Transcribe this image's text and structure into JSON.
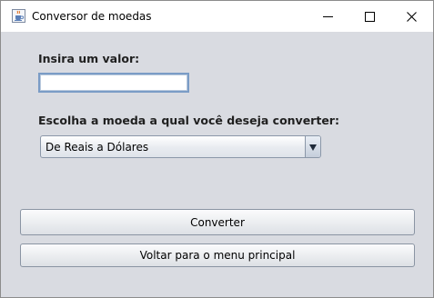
{
  "window": {
    "title": "Conversor de moedas",
    "icon": "java-cup-icon",
    "controls": [
      "minimize-icon",
      "maximize-icon",
      "close-icon"
    ]
  },
  "form": {
    "value_label": "Insira um valor:",
    "value_input": "",
    "currency_label": "Escolha a moeda a qual você deseja converter:",
    "currency_selected": "De Reais a Dólares"
  },
  "buttons": {
    "convert": "Converter",
    "back": "Voltar para o menu principal"
  },
  "colors": {
    "content_background": "#d9dbe1",
    "input_border": "#7a9cc6"
  }
}
